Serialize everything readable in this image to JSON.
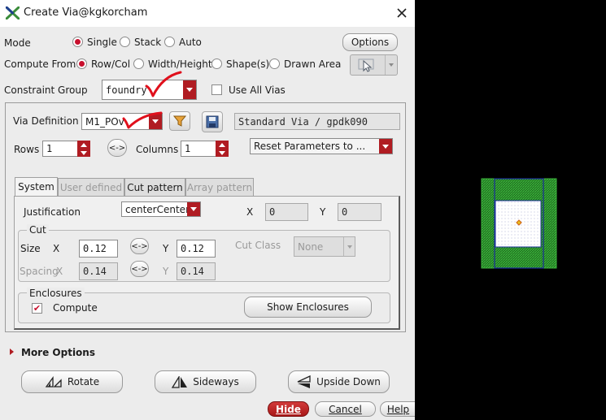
{
  "window": {
    "title": "Create Via@kgkorcham",
    "close_icon": "close-icon",
    "app_icon": "x-logo-icon"
  },
  "mode": {
    "label": "Mode",
    "options": [
      "Single",
      "Stack",
      "Auto"
    ],
    "selected": "Single",
    "options_button": "Options"
  },
  "compute_from": {
    "label": "Compute From",
    "options": [
      "Row/Col",
      "Width/Height",
      "Shape(s)",
      "Drawn Area"
    ],
    "selected": "Row/Col"
  },
  "constraint_group": {
    "label": "Constraint Group",
    "value": "foundry",
    "use_all_vias_label": "Use All Vias",
    "use_all_vias_checked": false
  },
  "via_definition": {
    "label": "Via Definition",
    "value": "M1_POv",
    "description": "Standard Via / gpdk090"
  },
  "rows": {
    "label": "Rows",
    "value": "1"
  },
  "columns": {
    "label": "Columns",
    "value": "1"
  },
  "swap_symbol": "<->",
  "reset_params": {
    "value": "Reset Parameters to ..."
  },
  "tabs": [
    {
      "label": "System",
      "state": "active"
    },
    {
      "label": "User defined",
      "state": "disabled"
    },
    {
      "label": "Cut pattern",
      "state": "normal"
    },
    {
      "label": "Array pattern",
      "state": "disabled"
    }
  ],
  "justification": {
    "label": "Justification",
    "value": "centerCenter",
    "x_label": "X",
    "x_value": "0",
    "y_label": "Y",
    "y_value": "0"
  },
  "cut": {
    "title": "Cut",
    "size_label": "Size",
    "x_label": "X",
    "size_x": "0.12",
    "y_label": "Y",
    "size_y": "0.12",
    "cut_class_label": "Cut Class",
    "cut_class_value": "None",
    "spacing_label": "Spacing",
    "spacing_x_label": "X",
    "spacing_x": "0.14",
    "spacing_y_label": "Y",
    "spacing_y": "0.14"
  },
  "enclosures": {
    "title": "Enclosures",
    "compute_label": "Compute",
    "compute_checked": true,
    "show_button": "Show Enclosures"
  },
  "more_options": "More Options",
  "transform_buttons": [
    "Rotate",
    "Sideways",
    "Upside Down"
  ],
  "footer": {
    "hide": "Hide",
    "cancel": "Cancel",
    "help": "Help"
  },
  "colors": {
    "accent": "#b01c22",
    "preview_enclosure": "#3cb43c",
    "preview_outline": "#1a2f9a",
    "annotation_check": "#e0101c"
  }
}
